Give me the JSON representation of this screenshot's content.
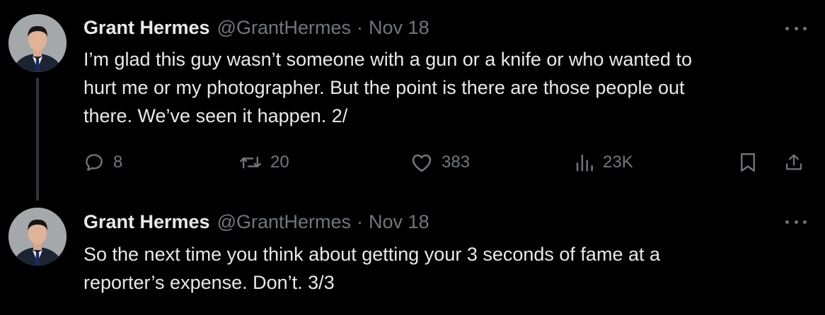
{
  "tweets": [
    {
      "author_name": "Grant Hermes",
      "handle": "@GrantHermes",
      "separator": "·",
      "date": "Nov 18",
      "lines": [
        "I’m glad this guy wasn’t someone with a gun or a knife or who wanted to",
        "hurt me or my photographer. But the point is there are those people out",
        "there. We’ve seen it happen. 2/"
      ],
      "actions": {
        "replies": "8",
        "reposts": "20",
        "likes": "383",
        "views": "23K"
      }
    },
    {
      "author_name": "Grant Hermes",
      "handle": "@GrantHermes",
      "separator": "·",
      "date": "Nov 18",
      "lines": [
        "So the next time you think about getting your 3 seconds of fame at a",
        "reporter’s expense. Don’t. 3/3"
      ]
    }
  ],
  "icons": {
    "reply": "reply-icon",
    "repost": "repost-icon",
    "like": "heart-icon",
    "views": "analytics-icon",
    "bookmark": "bookmark-icon",
    "share": "share-icon",
    "more": "more-icon"
  },
  "colors": {
    "background": "#000000",
    "primary_text": "#e7e9ea",
    "secondary_text": "#71767b",
    "thread_line": "#333639"
  }
}
